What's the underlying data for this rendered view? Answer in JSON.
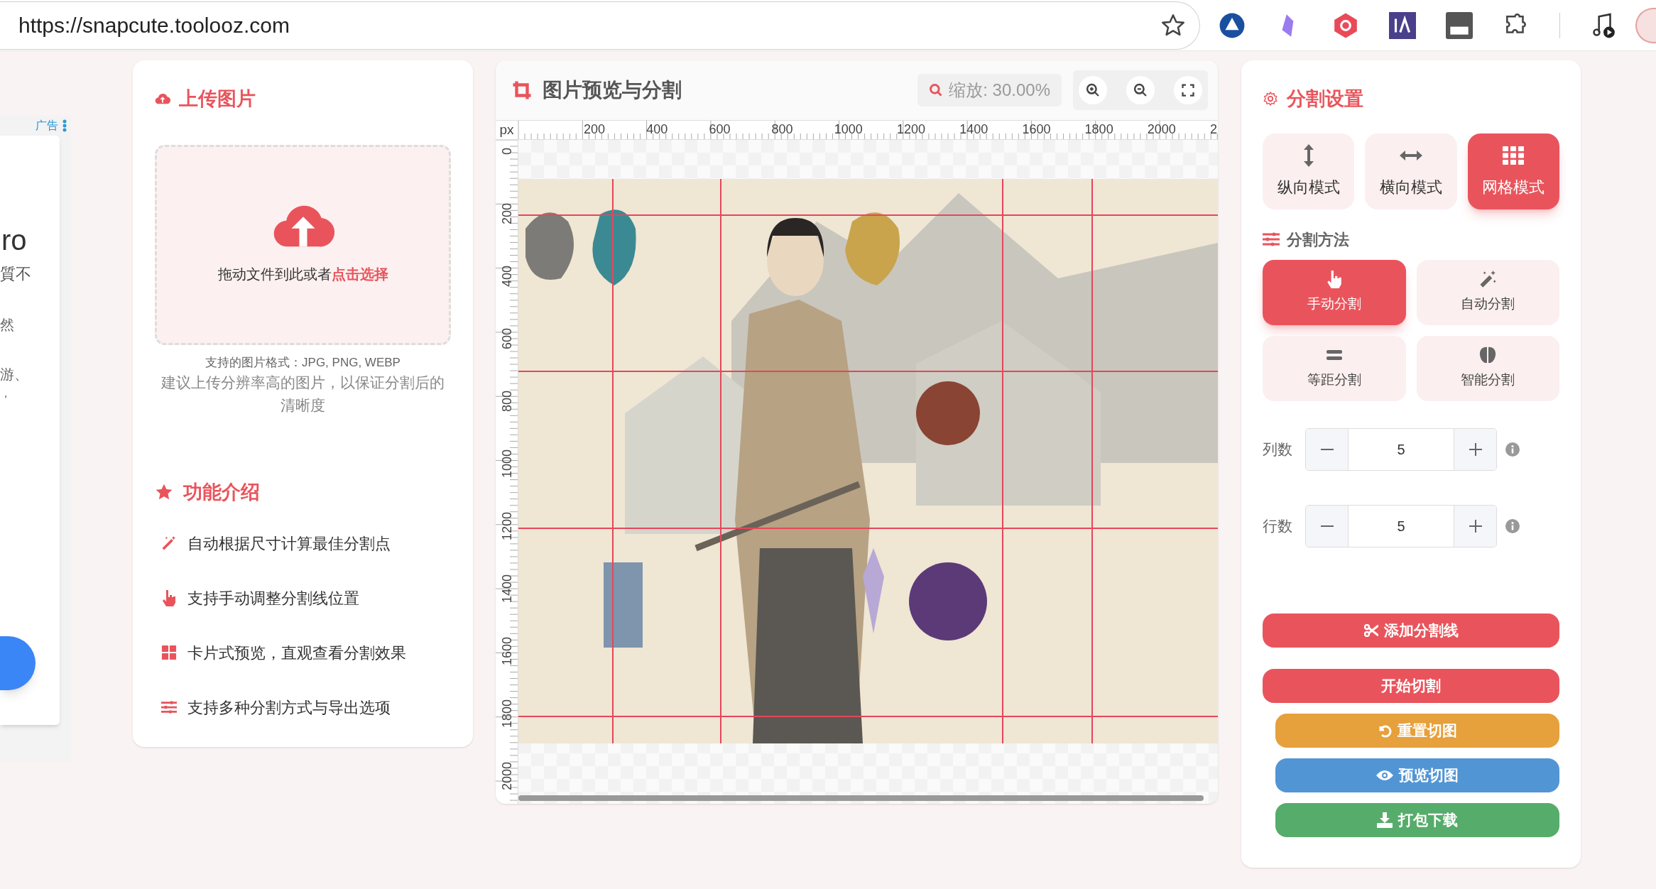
{
  "browser": {
    "url": "https://snapcute.toolooz.com"
  },
  "ad": {
    "label": "广告",
    "texts": [
      "ro",
      "質不",
      "然",
      "游、",
      "，"
    ]
  },
  "upload": {
    "title": "上传图片",
    "drop_text": "拖动文件到此或者",
    "drop_link": "点击选择",
    "formats": "支持的图片格式：JPG, PNG, WEBP",
    "hint": "建议上传分辨率高的图片，以保证分割后的清晰度",
    "features_title": "功能介绍",
    "features": [
      "自动根据尺寸计算最佳分割点",
      "支持手动调整分割线位置",
      "卡片式预览，直观查看分割效果",
      "支持多种分割方式与导出选项"
    ]
  },
  "preview": {
    "title": "图片预览与分割",
    "zoom": "缩放: 30.00%",
    "unit": "px",
    "x_ticks": [
      "200",
      "400",
      "600",
      "800",
      "1000",
      "1200",
      "1400",
      "1600",
      "1800",
      "2000",
      "2"
    ],
    "y_ticks": [
      "0",
      "200",
      "400",
      "600",
      "800",
      "1000",
      "1200",
      "1400",
      "1600",
      "1800",
      "2000"
    ]
  },
  "settings": {
    "title": "分割设置",
    "modes": [
      {
        "label": "纵向模式",
        "selected": false
      },
      {
        "label": "横向模式",
        "selected": false
      },
      {
        "label": "网格模式",
        "selected": true
      }
    ],
    "method_title": "分割方法",
    "methods": [
      {
        "label": "手动分割",
        "selected": true
      },
      {
        "label": "自动分割",
        "selected": false
      },
      {
        "label": "等距分割",
        "selected": false
      },
      {
        "label": "智能分割",
        "selected": false
      }
    ],
    "fields": [
      {
        "label": "列数",
        "value": "5"
      },
      {
        "label": "行数",
        "value": "5"
      }
    ],
    "buttons": [
      {
        "label": "添加分割线",
        "kind": "primary"
      },
      {
        "label": "开始切割",
        "kind": "primary"
      },
      {
        "label": "重置切图",
        "kind": "warning"
      },
      {
        "label": "预览切图",
        "kind": "info"
      },
      {
        "label": "打包下载",
        "kind": "success"
      }
    ]
  }
}
